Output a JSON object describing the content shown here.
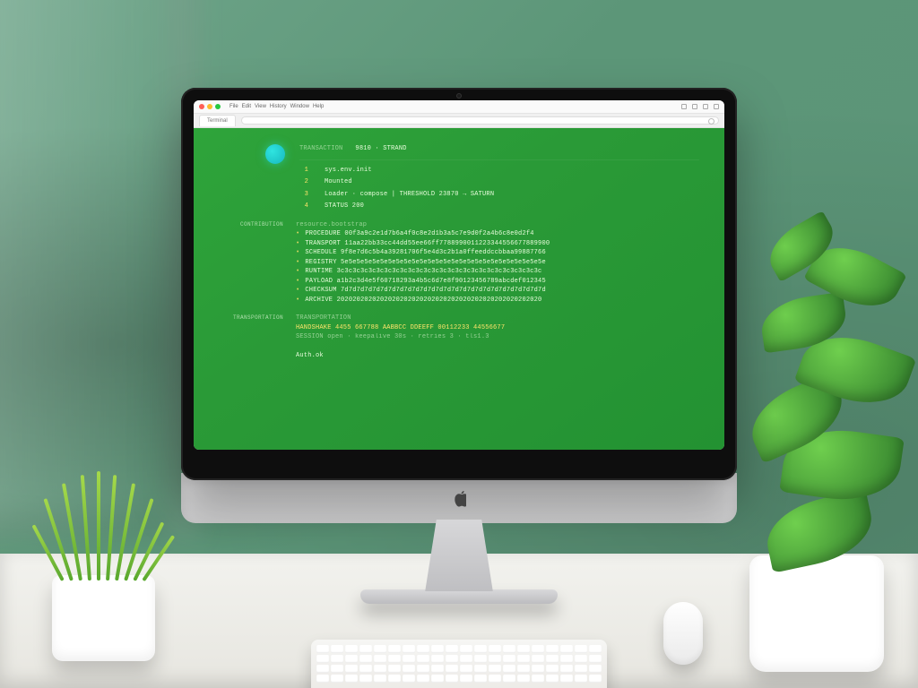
{
  "browser": {
    "menu_items": [
      "File",
      "Edit",
      "View",
      "History",
      "Window",
      "Help"
    ],
    "tab_label": "Terminal",
    "address_placeholder": ""
  },
  "terminal": {
    "header_label": "TRANSACTION",
    "header_value": "9810 · STRAND",
    "numbered": [
      "sys.env.init",
      "Mounted",
      "Loader · compose  |  THRESHOLD 23870 → SATURN",
      "STATUS 200"
    ],
    "sections": [
      {
        "label": "CONTRIBUTION",
        "lines": [
          "resource.bootstrap",
          "PROCEDURE 00f3a9c2e1d7b6a4f0c8e2d1b3a5c7e9d0f2a4b6c8e0d2f4",
          "TRANSPORT 11aa22bb33cc44dd55ee66ff7788990011223344556677889900",
          "SCHEDULE  9f8e7d6c5b4a39281706f5e4d3c2b1a0ffeeddccbbaa99887766",
          "REGISTRY  5e5e5e5e5e5e5e5e5e5e5e5e5e5e5e5e5e5e5e5e5e5e5e5e5e5e",
          "RUNTIME   3c3c3c3c3c3c3c3c3c3c3c3c3c3c3c3c3c3c3c3c3c3c3c3c3c3c",
          "PAYLOAD   a1b2c3d4e5f60718293a4b5c6d7e8f90123456789abcdef012345",
          "CHECKSUM  7d7d7d7d7d7d7d7d7d7d7d7d7d7d7d7d7d7d7d7d7d7d7d7d7d7d",
          "ARCHIVE   2020202020202020202020202020202020202020202020202020"
        ]
      },
      {
        "label": "TRANSPORTATION",
        "lines": [
          "TRANSPORTATION",
          "HANDSHAKE 4455 667788 AABBCC DDEEFF 00112233 44556677",
          "SESSION   open · keepalive 30s · retries 3 · tls1.3"
        ]
      }
    ],
    "footer_label": "Auth.ok"
  }
}
